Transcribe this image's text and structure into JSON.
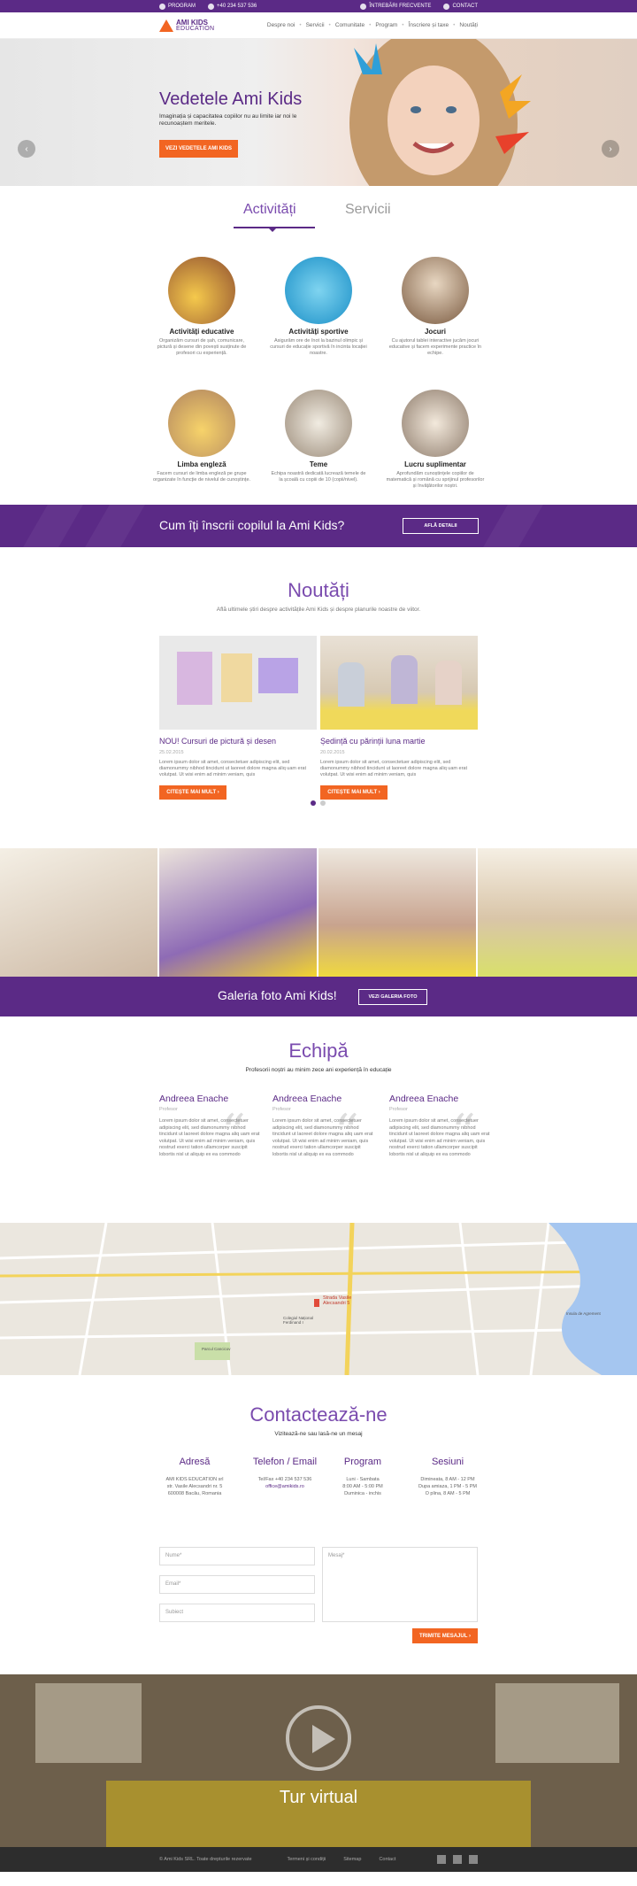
{
  "topbar": {
    "left": [
      {
        "icon": "calendar-icon",
        "label": "PROGRAM"
      },
      {
        "icon": "phone-icon",
        "label": "+40 234 537 536"
      }
    ],
    "right": [
      {
        "icon": "question-icon",
        "label": "ÎNTREBĂRI FRECVENTE"
      },
      {
        "icon": "mail-icon",
        "label": "CONTACT"
      }
    ]
  },
  "brand": {
    "line1": "AMI KIDS",
    "line2": "EDUCATION"
  },
  "nav": {
    "items": [
      "Despre noi",
      "Servicii",
      "Comunitate",
      "Program",
      "Înscriere și taxe",
      "Noutăți"
    ],
    "separator": "•"
  },
  "hero": {
    "title": "Vedetele Ami Kids",
    "text": "Imaginația și capacitatea copiilor nu au limite iar noi le recunoaștem meritele.",
    "button": "VEZI VEDETELE AMI KIDS",
    "prev": "‹",
    "next": "›"
  },
  "tabs": {
    "active": "Activități",
    "inactive": "Servicii"
  },
  "activities": [
    {
      "title": "Activități educative",
      "text": "Organizăm cursuri de șah, comunicare, pictură și desene din povești susținute de profesori cu experiență."
    },
    {
      "title": "Activități sportive",
      "text": "Asigurăm ore de înot la bazinul olimpic și cursuri de educație sportivă în incinta locației noastre."
    },
    {
      "title": "Jocuri",
      "text": "Cu ajutorul tablei interactive jucăm jocuri educative și facem experimente practice în echipe."
    },
    {
      "title": "Limba engleză",
      "text": "Facem cursuri de limba engleză pe grupe organizate în funcție de nivelul de cunoștințe."
    },
    {
      "title": "Teme",
      "text": "Echipa noastră dedicată lucrează temele de la școală cu copiii de 10 (copii/nivel)."
    },
    {
      "title": "Lucru suplimentar",
      "text": "Aprofundăm cunoștințele copiilor de matematică și română cu sprijinul profesorilor și învățătorilor noștri."
    }
  ],
  "enroll": {
    "text": "Cum îți înscrii copilul la Ami Kids?",
    "button": "AFLĂ DETALII"
  },
  "news": {
    "title": "Noutăți",
    "subtitle": "Află ultimele știri despre activitățile Ami Kids și despre planurile noastre de viitor.",
    "items": [
      {
        "title": "NOU! Cursuri de pictură și desen",
        "date": "25.02.2015",
        "text": "Lorem ipsum dolor sit amet, consectetuer adipiscing elit, sed diamonummy nibhod tincidunt ut laoreet dolore magna aliq uam erat volutpat. Ut wisi enim ad minim veniam, quis",
        "button": "CITEȘTE MAI MULT ›"
      },
      {
        "title": "Ședință cu părinții luna martie",
        "date": "20.02.2015",
        "text": "Lorem ipsum dolor sit amet, consectetuer adipiscing elit, sed diamonummy nibhod tincidunt ut laoreet dolore magna aliq uam erat volutpat. Ut wisi enim ad minim veniam, quis",
        "button": "CITEȘTE MAI MULT ›"
      }
    ]
  },
  "gallery": {
    "text": "Galeria foto Ami Kids!",
    "button": "VEZI GALERIA FOTO"
  },
  "team": {
    "title": "Echipă",
    "subtitle": "Profesorii noștri au minim zece ani experiență în educație",
    "members": [
      {
        "name": "Andreea Enache",
        "role": "Profesor",
        "text": "Lorem ipsum dolor sit amet, consectetuer adipiscing elit, sed diamonummy nibhod tincidunt ut laoreet dolore magna aliq uam erat volutpat. Ut wisi enim ad minim veniam, quis nostrud exerci tation ullamcorper suscipit lobortis nisl ut aliquip ex ea commodo"
      },
      {
        "name": "Andreea Enache",
        "role": "Profesor",
        "text": "Lorem ipsum dolor sit amet, consectetuer adipiscing elit, sed diamonummy nibhod tincidunt ut laoreet dolore magna aliq uam erat volutpat. Ut wisi enim ad minim veniam, quis nostrud exerci tation ullamcorper suscipit lobortis nisl ut aliquip ex ea commodo"
      },
      {
        "name": "Andreea Enache",
        "role": "Profesor",
        "text": "Lorem ipsum dolor sit amet, consectetuer adipiscing elit, sed diamonummy nibhod tincidunt ut laoreet dolore magna aliq uam erat volutpat. Ut wisi enim ad minim veniam, quis nostrud exerci tation ullamcorper suscipit lobortis nisl ut aliquip ex ea commodo"
      }
    ]
  },
  "map": {
    "pin_label": "Strada Vasile Alecsandri 5",
    "labels": [
      "Colegiul Național Ferdinand I",
      "Parcul Cancicov",
      "Insula de Agrement"
    ]
  },
  "contact": {
    "title": "Contactează-ne",
    "subtitle": "Vizitează-ne sau lasă-ne un mesaj",
    "cols": [
      {
        "title": "Adresă",
        "lines": [
          "AMI KIDS EDUCATION srl",
          "str. Vasile Alecsandri nr. 5",
          "600008 Bacău, Romania"
        ]
      },
      {
        "title": "Telefon / Email",
        "lines": [
          "Tel/Fax +40 234 537 536",
          "office@amikids.ro"
        ]
      },
      {
        "title": "Program",
        "lines": [
          "Luni - Sambata",
          "8:00 AM - 5:00 PM",
          "Duminica - inchis"
        ]
      },
      {
        "title": "Sesiuni",
        "lines": [
          "Dimineata, 8 AM - 12 PM",
          "Dupa amiaza, 1 PM - 5 PM",
          "O plina, 8 AM - 5 PM"
        ]
      }
    ],
    "form": {
      "name": "Nume*",
      "email": "Email*",
      "subject": "Subiect",
      "message": "Mesaj*",
      "submit": "TRIMITE MESAJUL ›"
    }
  },
  "video": {
    "title": "Tur virtual"
  },
  "footer": {
    "copy": "© Ami Kids SRL. Toate drepturile rezervate",
    "links": [
      "Termeni și condiții",
      "Sitemap",
      "Contact"
    ]
  },
  "colors": {
    "purple": "#5b2a86",
    "orange": "#f26522"
  }
}
